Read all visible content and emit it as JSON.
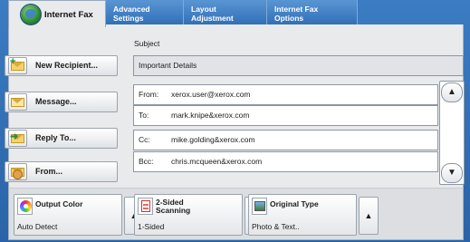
{
  "tabs": [
    {
      "label": "Internet Fax",
      "active": true
    },
    {
      "label": "Advanced\nSettings",
      "active": false
    },
    {
      "label": "Layout\nAdjustment",
      "active": false
    },
    {
      "label": "Internet Fax\nOptions",
      "active": false
    }
  ],
  "left_buttons": {
    "new_recipient": "New Recipient...",
    "message": "Message...",
    "reply_to": "Reply To...",
    "from": "From..."
  },
  "subject": {
    "label": "Subject",
    "value": "Important Details"
  },
  "fields": [
    {
      "label": "From:",
      "value": "xerox.user@xerox.com"
    },
    {
      "label": "To:",
      "value": "mark.knipe&xerox.com"
    },
    {
      "label": "Cc:",
      "value": "mike.golding&xerox.com"
    },
    {
      "label": "Bcc:",
      "value": "chris.mcqueen&xerox.com"
    }
  ],
  "scroll": {
    "up": "▲",
    "down": "▼"
  },
  "bottom": [
    {
      "title": "Output Color",
      "value": "Auto Detect",
      "icon": "color-wheel-icon"
    },
    {
      "title": "2-Sided\nScanning",
      "value": "1-Sided",
      "icon": "two-sided-icon"
    },
    {
      "title": "Original Type",
      "value": "Photo & Text..",
      "icon": "photo-icon"
    }
  ],
  "colors": {
    "accent": "#2f6fb6",
    "panel": "#e9eaec"
  }
}
